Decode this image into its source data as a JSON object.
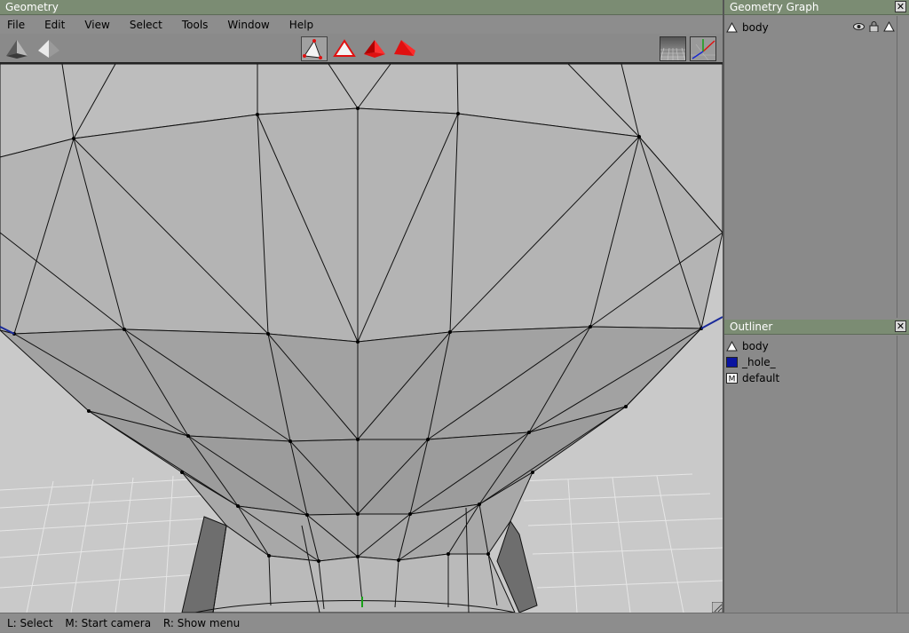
{
  "window": {
    "title": "Geometry"
  },
  "menu": {
    "items": [
      "File",
      "Edit",
      "View",
      "Select",
      "Tools",
      "Window",
      "Help"
    ]
  },
  "toolbar": {
    "left_tools": [
      "shaded-pyramid-icon",
      "flat-pyramid-icon"
    ],
    "select_modes": [
      "vertex-select-icon",
      "edge-select-icon",
      "face-select-icon",
      "object-select-icon"
    ],
    "right_tools": [
      "grid-toggle-icon",
      "axes-toggle-icon"
    ]
  },
  "geometry_graph": {
    "title": "Geometry Graph",
    "items": [
      {
        "label": "body",
        "icon": "triangle-icon",
        "flags": [
          "eye-icon",
          "lock-icon",
          "triangle-icon"
        ]
      }
    ]
  },
  "outliner": {
    "title": "Outliner",
    "items": [
      {
        "label": "body",
        "icon": "triangle-icon"
      },
      {
        "label": "_hole_",
        "icon": "blue-square-icon",
        "color": "#0a14a0"
      },
      {
        "label": "default",
        "icon": "material-m-icon"
      }
    ]
  },
  "status": {
    "hints": [
      "L: Select",
      "M: Start camera",
      "R: Show menu"
    ]
  },
  "colors": {
    "title_bar": "#7b8c73",
    "viewport_bg": "#c9c9c9",
    "selection_red": "#e01010"
  }
}
